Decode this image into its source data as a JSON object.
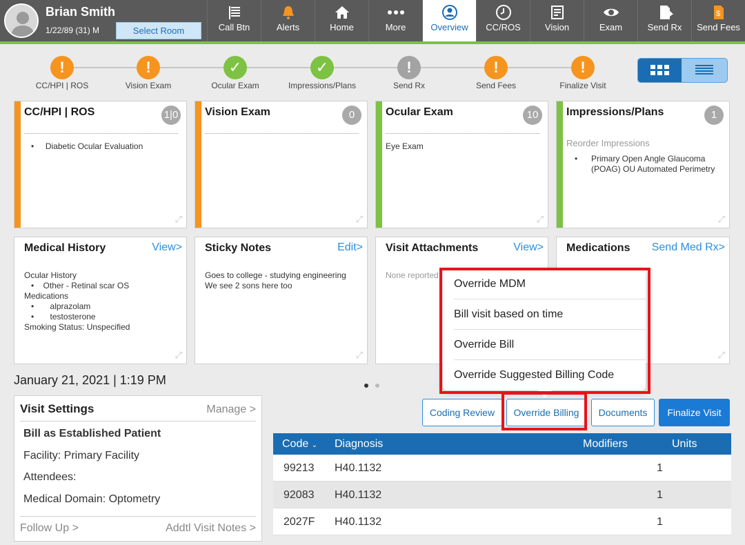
{
  "patient": {
    "name": "Brian Smith",
    "dob": "1/22/89 (31) M",
    "select_room": "Select Room"
  },
  "nav": [
    {
      "label": "Call Btn",
      "icon": "call-button-icon"
    },
    {
      "label": "Alerts",
      "icon": "bell-icon"
    },
    {
      "label": "Home",
      "icon": "home-icon"
    },
    {
      "label": "More",
      "icon": "more-icon"
    },
    {
      "label": "Overview",
      "icon": "user-circle-icon",
      "active": true
    },
    {
      "label": "CC/ROS",
      "icon": "clock-icon"
    },
    {
      "label": "Vision",
      "icon": "vision-icon"
    },
    {
      "label": "Exam",
      "icon": "eye-icon"
    },
    {
      "label": "Send Rx",
      "icon": "send-rx-icon"
    },
    {
      "label": "Send Fees",
      "icon": "send-fees-icon"
    }
  ],
  "steps": [
    {
      "label": "CC/HPI | ROS",
      "status": "warning"
    },
    {
      "label": "Vision Exam",
      "status": "warning"
    },
    {
      "label": "Ocular Exam",
      "status": "complete"
    },
    {
      "label": "Impressions/Plans",
      "status": "complete"
    },
    {
      "label": "Send Rx",
      "status": "inactive"
    },
    {
      "label": "Send Fees",
      "status": "warning"
    },
    {
      "label": "Finalize Visit",
      "status": "warning"
    }
  ],
  "cards": {
    "cc": {
      "title": "CC/HPI | ROS",
      "badge": "1|0",
      "item": "Diabetic Ocular Evaluation"
    },
    "vision": {
      "title": "Vision Exam",
      "badge": "0"
    },
    "ocular": {
      "title": "Ocular Exam",
      "badge": "10",
      "item": "Eye Exam"
    },
    "impressions": {
      "title": "Impressions/Plans",
      "badge": "1",
      "reorder": "Reorder Impressions",
      "item": "Primary Open Angle Glaucoma (POAG) OU Automated Perimetry"
    },
    "history": {
      "title": "Medical History",
      "link": "View>",
      "lines": [
        "Ocular History",
        "Other - Retinal scar OS",
        "Medications",
        "alprazolam",
        "testosterone",
        "Smoking Status: Unspecified"
      ]
    },
    "sticky": {
      "title": "Sticky Notes",
      "link": "Edit>",
      "lines": [
        "Goes to college - studying engineering",
        "We see 2 sons here too"
      ]
    },
    "attachments": {
      "title": "Visit Attachments",
      "link": "View>",
      "empty": "None reported"
    },
    "medications": {
      "title": "Medications",
      "link": "Send Med Rx>"
    }
  },
  "date_line": "January 21, 2021 | 1:19 PM",
  "visit_settings": {
    "title": "Visit Settings",
    "manage": "Manage >",
    "bill_as": "Bill as Established Patient",
    "facility": "Facility: Primary Facility",
    "attendees": "Attendees:",
    "domain": "Medical Domain: Optometry",
    "follow_up": "Follow Up >",
    "notes": "Addtl Visit Notes >"
  },
  "buttons": {
    "coding_review": "Coding Review",
    "override_billing": "Override Billing",
    "documents": "Documents",
    "finalize": "Finalize Visit"
  },
  "menu": [
    "Override MDM",
    "Bill visit based on time",
    "Override Bill",
    "Override Suggested Billing Code"
  ],
  "table": {
    "headers": {
      "code": "Code",
      "diagnosis": "Diagnosis",
      "modifiers": "Modifiers",
      "units": "Units"
    },
    "rows": [
      {
        "code": "99213",
        "diagnosis": "H40.1132",
        "modifiers": "",
        "units": "1"
      },
      {
        "code": "92083",
        "diagnosis": "H40.1132",
        "modifiers": "",
        "units": "1"
      },
      {
        "code": "2027F",
        "diagnosis": "H40.1132",
        "modifiers": "",
        "units": "1"
      }
    ]
  },
  "colors": {
    "accent_blue": "#1a6db3",
    "warning": "#f5941f",
    "complete": "#7dc242",
    "highlight": "#e8131a"
  }
}
